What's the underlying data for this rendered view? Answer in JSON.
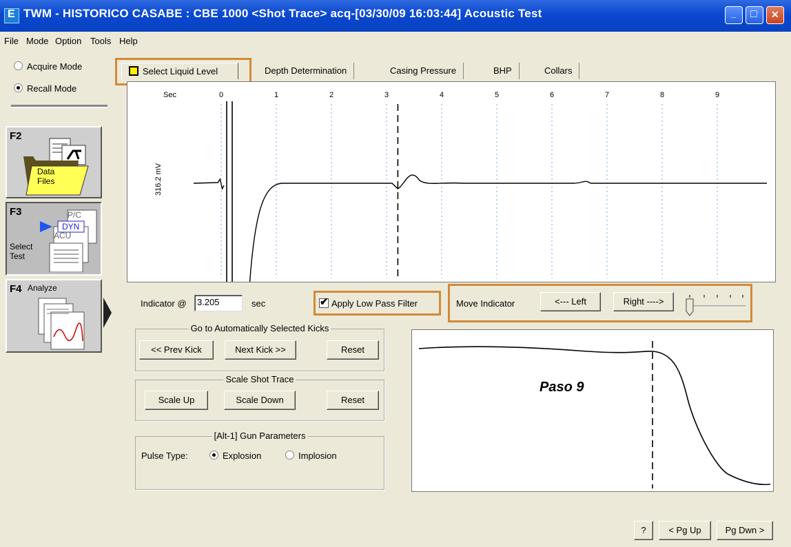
{
  "window": {
    "title": "TWM  -  HISTORICO CASABE : CBE 1000  <Shot Trace>  acq-[03/30/09 16:03:44]  Acoustic Test",
    "minimize_glyph": "_",
    "maximize_glyph": "□",
    "close_glyph": "✕"
  },
  "menu": [
    "File",
    "Mode",
    "Option",
    "Tools",
    "Help"
  ],
  "mode": {
    "acquire": "Acquire Mode",
    "recall": "Recall Mode",
    "selected": "recall"
  },
  "fkeys": {
    "f2": {
      "key": "F2",
      "label_line1": "Data",
      "label_line2": "Files"
    },
    "f3": {
      "key": "F3",
      "pc": "P/C",
      "dyn": "DYN",
      "acu": "ACU",
      "label_line1": "Select",
      "label_line2": "Test"
    },
    "f4": {
      "key": "F4",
      "label": "Analyze"
    }
  },
  "tabs": [
    "Select Liquid Level",
    "Depth Determination",
    "Casing Pressure",
    "BHP",
    "Collars"
  ],
  "chart_data": {
    "type": "line",
    "title": "",
    "xlabel": "Sec",
    "ylabel": "316.2 mV",
    "xticks": [
      "0",
      "1",
      "2",
      "3",
      "4",
      "5",
      "6",
      "7",
      "8",
      "9"
    ],
    "indicator_sec": 3.205,
    "xlim": [
      -0.5,
      9.9
    ]
  },
  "controls": {
    "indicator_label": "Indicator @",
    "indicator_value": "3.205",
    "indicator_unit": "sec",
    "filter_label": "Apply Low Pass Filter",
    "filter_checked": true,
    "move_indicator": "Move Indicator",
    "left_btn": "<--- Left",
    "right_btn": "Right ---->"
  },
  "kicks_group": {
    "title": "Go to Automatically Selected Kicks",
    "prev": "<< Prev Kick",
    "next": "Next Kick >>",
    "reset": "Reset"
  },
  "scale_group": {
    "title": "Scale Shot Trace",
    "up": "Scale Up",
    "down": "Scale Down",
    "reset": "Reset"
  },
  "gun_group": {
    "title": "[Alt-1]  Gun Parameters",
    "pulse_label": "Pulse Type:",
    "explosion": "Explosion",
    "implosion": "Implosion",
    "selected": "explosion"
  },
  "annotation": "Paso 9",
  "footer": {
    "help": "?",
    "pgup": "< Pg Up",
    "pgdn": "Pg Dwn >"
  }
}
